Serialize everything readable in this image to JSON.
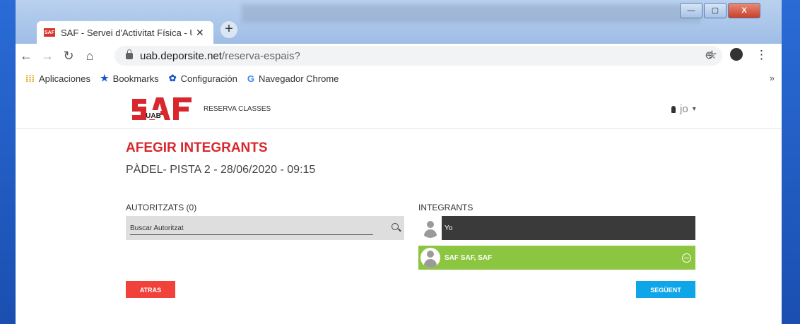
{
  "browser": {
    "tab_title": "SAF - Servei d'Activitat Física - Uni",
    "tab_favicon_text": "SAF",
    "tab_close": "✕",
    "new_tab": "+",
    "window_minimize": "—",
    "window_maximize": "▢",
    "window_close": "X",
    "url_host": "uab.deporsite.net",
    "url_path": "/reserva-espais?",
    "bookmarks": [
      {
        "label": "Aplicaciones",
        "icon": "apps-grid-icon"
      },
      {
        "label": "Bookmarks",
        "icon": "star-icon"
      },
      {
        "label": "Configuración",
        "icon": "gear-icon"
      },
      {
        "label": "Navegador Chrome",
        "icon": "google-icon"
      }
    ],
    "bookmarks_more": "»"
  },
  "site": {
    "logo_text": "SAF",
    "logo_sub": "UAB",
    "nav_link": "RESERVA CLASSES",
    "user_label": "jo",
    "user_caret": "▾",
    "brand_color": "#d9272e"
  },
  "main": {
    "heading": "AFEGIR INTEGRANTS",
    "subheading": "PÀDEL- PISTA 2 - 28/06/2020 - 09:15",
    "authorized_label": "AUTORITZATS (0)",
    "search_placeholder": "Buscar Autoritzat",
    "members_label": "INTEGRANTS",
    "members": [
      {
        "name": "Yo",
        "style": "dark",
        "removable": false
      },
      {
        "name": "SAF SAF, SAF",
        "style": "green",
        "removable": true
      }
    ],
    "back_label": "ATRAS",
    "next_label": "SEGÜENT",
    "back_color": "#f0423a",
    "next_color": "#0ea5e9",
    "member_green": "#8cc540",
    "member_dark": "#3a3a3a"
  }
}
